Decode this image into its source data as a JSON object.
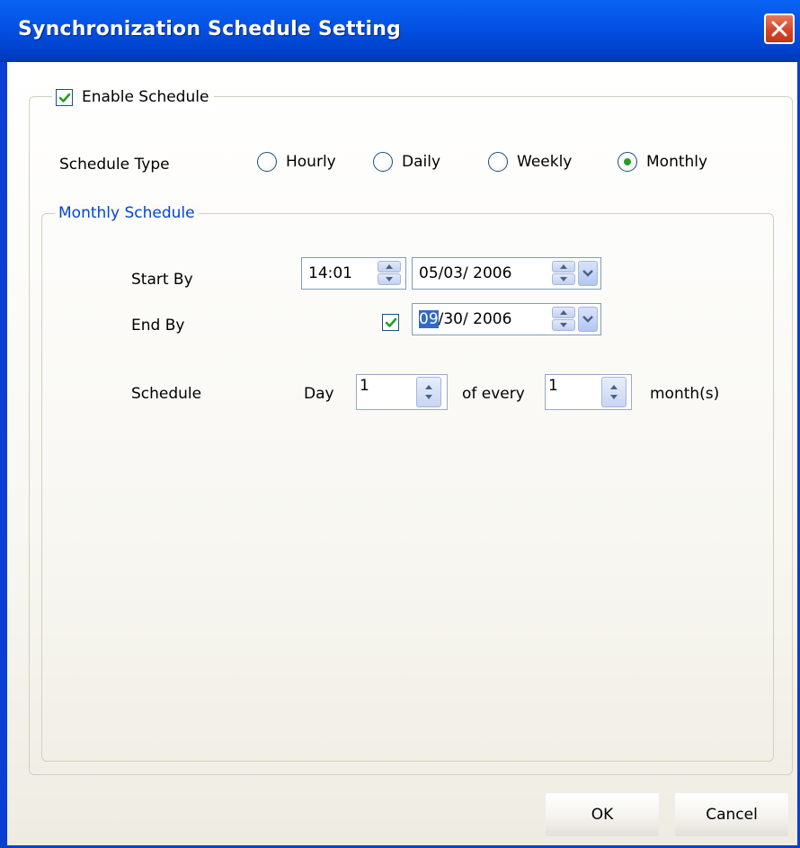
{
  "window": {
    "title": "Synchronization Schedule Setting"
  },
  "enable_schedule": {
    "label": "Enable Schedule",
    "checked": true
  },
  "schedule_type": {
    "label": "Schedule Type",
    "options": [
      "Hourly",
      "Daily",
      "Weekly",
      "Monthly"
    ],
    "selected": "Monthly"
  },
  "monthly": {
    "legend": "Monthly Schedule",
    "start_by": {
      "label": "Start By",
      "time": "14:01",
      "date": "05/03/ 2006"
    },
    "end_by": {
      "label": "End By",
      "enabled": true,
      "date_selected_part": "09",
      "date_rest": "/30/ 2006"
    },
    "schedule": {
      "label": "Schedule",
      "day_label": "Day",
      "day_value": "1",
      "of_every_label": "of every",
      "month_value": "1",
      "months_label": "month(s)"
    }
  },
  "buttons": {
    "ok": "OK",
    "cancel": "Cancel"
  },
  "colors": {
    "title_bar": "#0453e6",
    "legend_text": "#0046d5",
    "radio_selected": "#21a121",
    "check_mark": "#21a121"
  }
}
